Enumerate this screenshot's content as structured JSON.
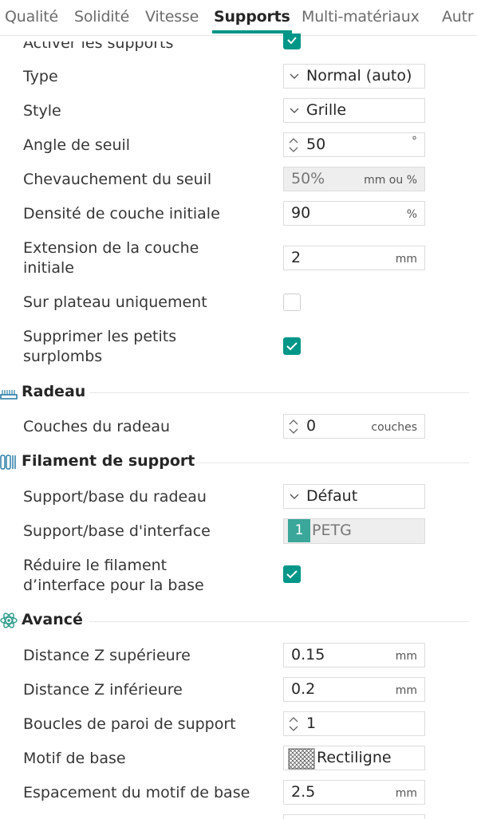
{
  "tabs": [
    "Qualité",
    "Solidité",
    "Vitesse",
    "Supports",
    "Multi-matériaux",
    "Autr"
  ],
  "active_tab": "Supports",
  "accent_color": "#009688",
  "rows": {
    "enable_supports": {
      "label": "Activer les supports",
      "checked": true
    },
    "type": {
      "label": "Type",
      "value": "Normal (auto)"
    },
    "style": {
      "label": "Style",
      "value": "Grille"
    },
    "threshold_angle": {
      "label": "Angle de seuil",
      "value": "50",
      "unit": "°"
    },
    "threshold_overlap": {
      "label": "Chevauchement du seuil",
      "value": "50%",
      "unit": "mm ou %"
    },
    "initial_layer_density": {
      "label": "Densité de couche initiale",
      "value": "90",
      "unit": "%"
    },
    "initial_layer_expansion": {
      "label_line1": "Extension de la couche",
      "label_line2": "initiale",
      "value": "2",
      "unit": "mm"
    },
    "on_build_plate_only": {
      "label": "Sur plateau uniquement",
      "checked": false
    },
    "remove_small_overhangs": {
      "label_line1": "Supprimer les petits",
      "label_line2": "surplombs",
      "checked": true
    }
  },
  "raft": {
    "title": "Radeau",
    "icon": "raft-icon",
    "raft_layers": {
      "label": "Couches du radeau",
      "value": "0",
      "unit": "couches"
    }
  },
  "support_filament": {
    "title": "Filament de support",
    "icon": "filament-icon",
    "base_filament": {
      "label": "Support/base du radeau",
      "value": "Défaut"
    },
    "interface_filament": {
      "label": "Support/base d'interface",
      "badge": "1",
      "value": "PETG"
    },
    "reduce_interface": {
      "label_line1": "Réduire le filament",
      "label_line2": "d’interface pour la base",
      "checked": true
    }
  },
  "advanced": {
    "title": "Avancé",
    "icon": "atom-icon",
    "top_z_distance": {
      "label": "Distance Z supérieure",
      "value": "0.15",
      "unit": "mm"
    },
    "bottom_z_distance": {
      "label": "Distance Z inférieure",
      "value": "0.2",
      "unit": "mm"
    },
    "wall_loops": {
      "label": "Boucles de paroi de support",
      "value": "1"
    },
    "base_pattern": {
      "label": "Motif de base",
      "value": "Rectiligne",
      "icon": "pattern-hatch-icon"
    },
    "base_pattern_spacing": {
      "label": "Espacement du motif de base",
      "value": "2.5",
      "unit": "mm"
    }
  }
}
